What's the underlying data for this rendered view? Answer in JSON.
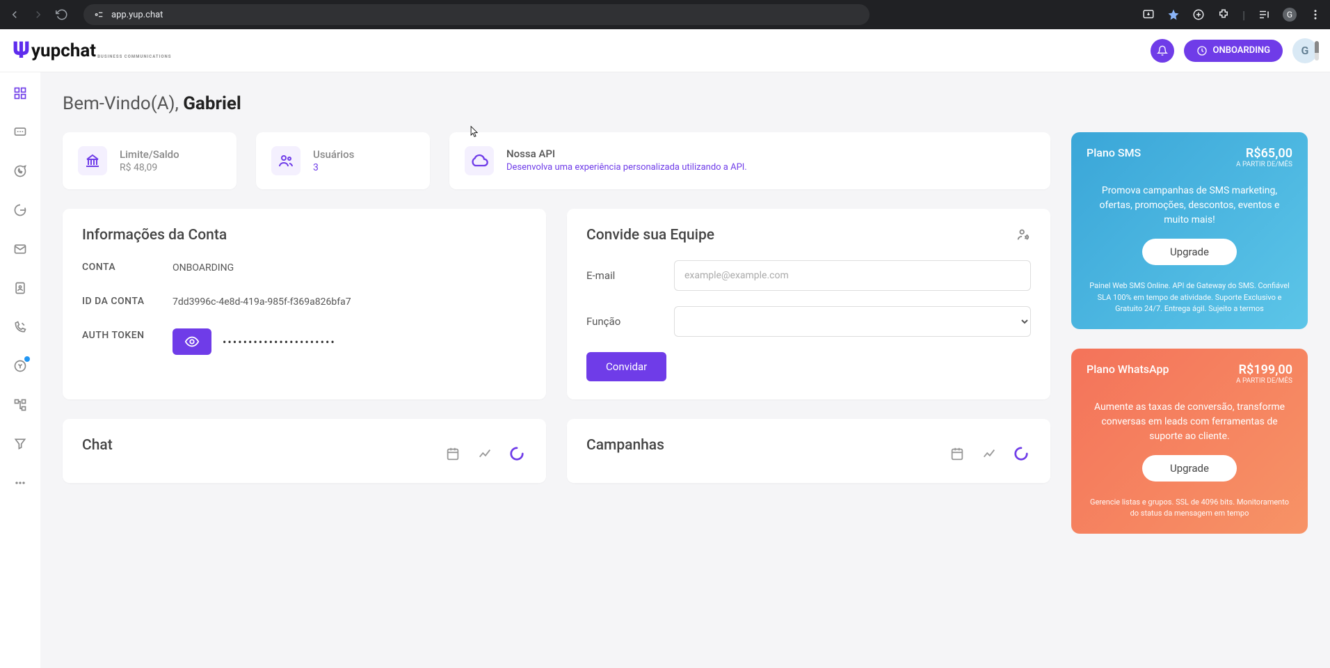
{
  "browser": {
    "url": "app.yup.chat",
    "profile_letter": "G"
  },
  "header": {
    "onboarding_label": "ONBOARDING",
    "avatar_letter": "G"
  },
  "welcome": {
    "prefix": "Bem-Vindo(A),  ",
    "name": "Gabriel"
  },
  "stats": {
    "balance": {
      "label": "Limite/Saldo",
      "value": "R$ 48,09"
    },
    "users": {
      "label": "Usuários",
      "value": "3"
    },
    "api": {
      "label": "Nossa API",
      "value": "Desenvolva uma experiência personalizada utilizando a API."
    }
  },
  "account": {
    "title": "Informações da Conta",
    "rows": {
      "account_label": "CONTA",
      "account_value": "ONBOARDING",
      "id_label": "ID DA CONTA",
      "id_value": "7dd3996c-4e8d-419a-985f-f369a826bfa7",
      "token_label": "AUTH TOKEN",
      "token_mask": "••••••••••••••••••••••"
    }
  },
  "invite": {
    "title": "Convide sua Equipe",
    "email_label": "E-mail",
    "email_placeholder": "example@example.com",
    "role_label": "Função",
    "button": "Convidar"
  },
  "sections": {
    "chat": "Chat",
    "campaigns": "Campanhas"
  },
  "plans": {
    "sms": {
      "name": "Plano SMS",
      "price": "R$65,00",
      "unit": "A PARTIR DE/MÊS",
      "desc": "Promova campanhas de SMS marketing, ofertas, promoções, descontos, eventos e muito mais!",
      "button": "Upgrade",
      "foot": "Painel Web SMS Online. API de Gateway do SMS. Confiável SLA 100% em tempo de atividade. Suporte Exclusivo e Gratuito 24/7. Entrega ágil. Sujeito a termos"
    },
    "wa": {
      "name": "Plano WhatsApp",
      "price": "R$199,00",
      "unit": "A PARTIR DE/MÊS",
      "desc": "Aumente as taxas de conversão, transforme conversas em leads com ferramentas de suporte ao cliente.",
      "button": "Upgrade",
      "foot": "Gerencie listas e grupos. SSL de 4096 bits. Monitoramento do status da mensagem em tempo"
    }
  }
}
